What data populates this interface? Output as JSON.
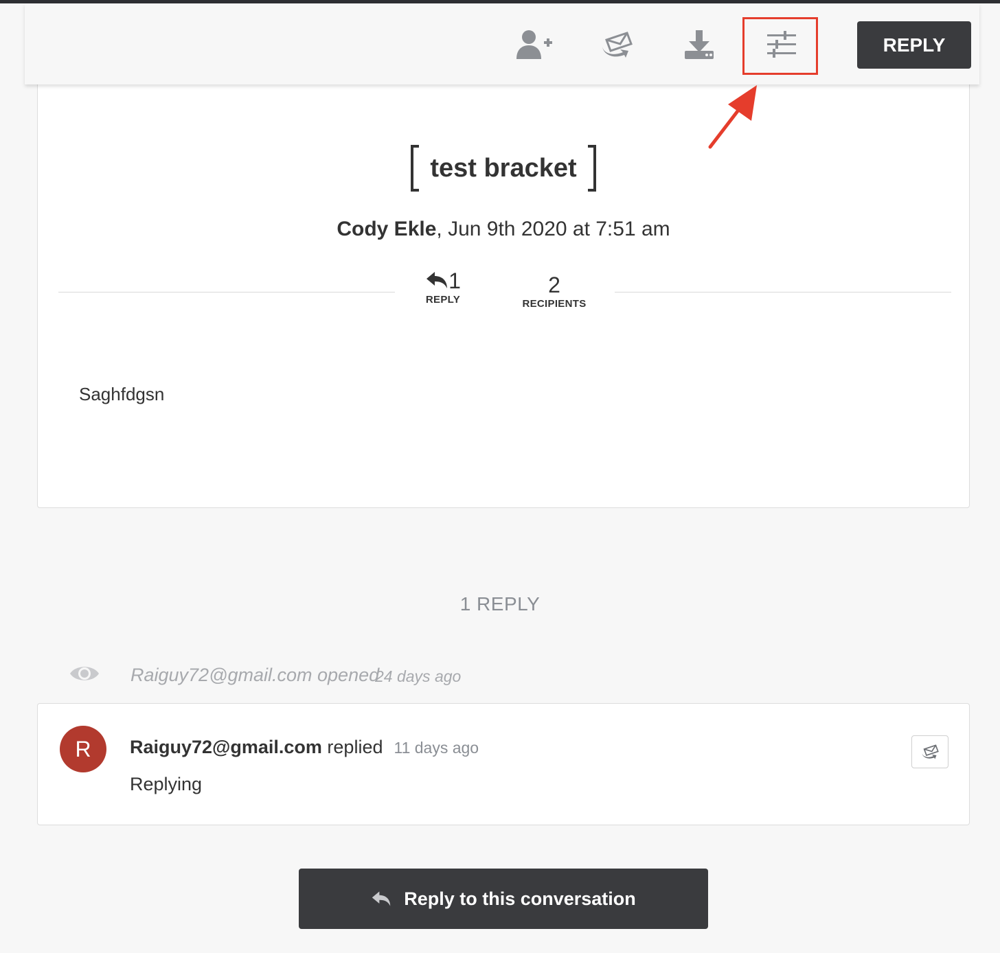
{
  "toolbar": {
    "icons": [
      "add-recipient-icon",
      "forward-mail-icon",
      "download-icon",
      "settings-sliders-icon"
    ],
    "reply_label": "REPLY",
    "highlight_color": "#e53d2c"
  },
  "message": {
    "title": "test bracket",
    "author": "Cody Ekle",
    "date": ", Jun 9th 2020 at 7:51 am",
    "reply_count": "1",
    "reply_label": "REPLY",
    "recipient_count": "2",
    "recipient_label": "RECIPIENTS",
    "body": "Saghfdgsn"
  },
  "replies": {
    "count_label": "1 REPLY",
    "opened_text": "Raiguy72@gmail.com opened",
    "opened_ago": "24 days ago",
    "items": [
      {
        "avatar_letter": "R",
        "avatar_color": "#b23a2e",
        "author": "Raiguy72@gmail.com",
        "action": " replied",
        "ago": "11 days ago",
        "body": "Replying"
      }
    ]
  },
  "footer": {
    "reply_button_label": "Reply to this conversation"
  }
}
